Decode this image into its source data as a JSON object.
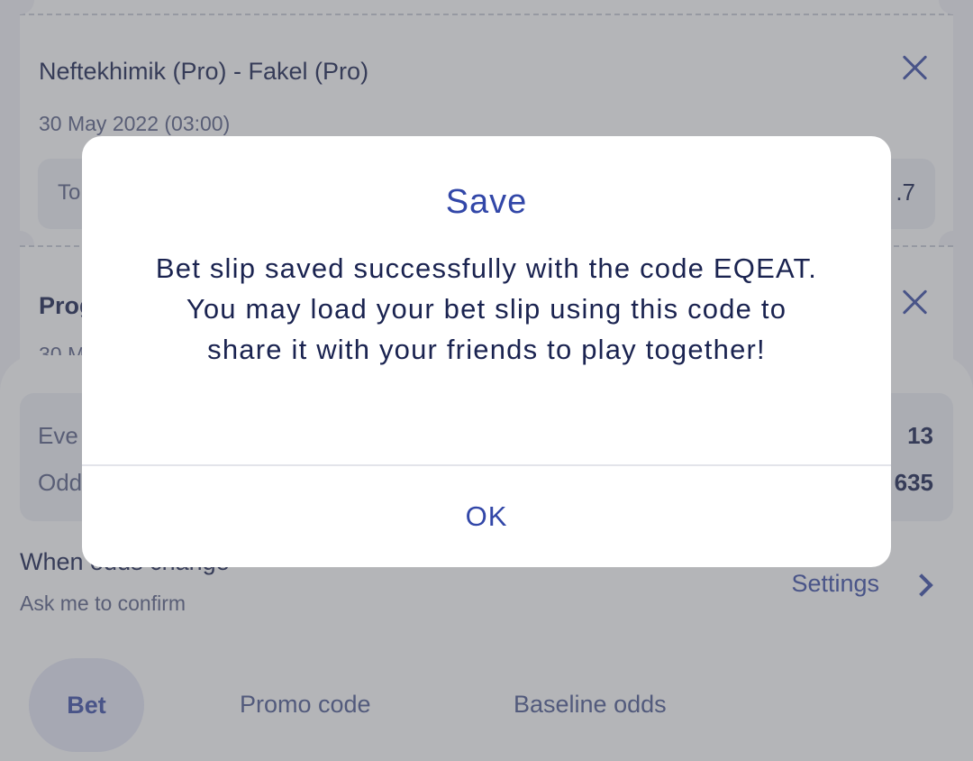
{
  "tickets": [
    {
      "title": "Neftekhimik (Pro) - Fakel (Pro)",
      "date": "30 May 2022 (03:00)",
      "bet_label_partial": "To",
      "odd_partial": ".7"
    },
    {
      "title_partial": "Prog",
      "date_partial": "30 M"
    }
  ],
  "summary": {
    "events_label_partial": "Eve",
    "events_value": "13",
    "odds_label_partial": "Odd",
    "odds_value_partial": "635"
  },
  "odds_change": {
    "label": "When odds change",
    "sub": "Ask me to confirm",
    "settings": "Settings"
  },
  "tabs": [
    "Bet",
    "Promo code",
    "Baseline odds"
  ],
  "dialog": {
    "title": "Save",
    "message": "Bet slip saved successfully with the code EQEAT. You may load your bet slip using this code to share it with your friends to play together!",
    "ok": "OK"
  },
  "colors": {
    "accent": "#3247a8",
    "text_dark": "#1a2350",
    "overlay": "rgba(88,90,98,0.45)"
  }
}
